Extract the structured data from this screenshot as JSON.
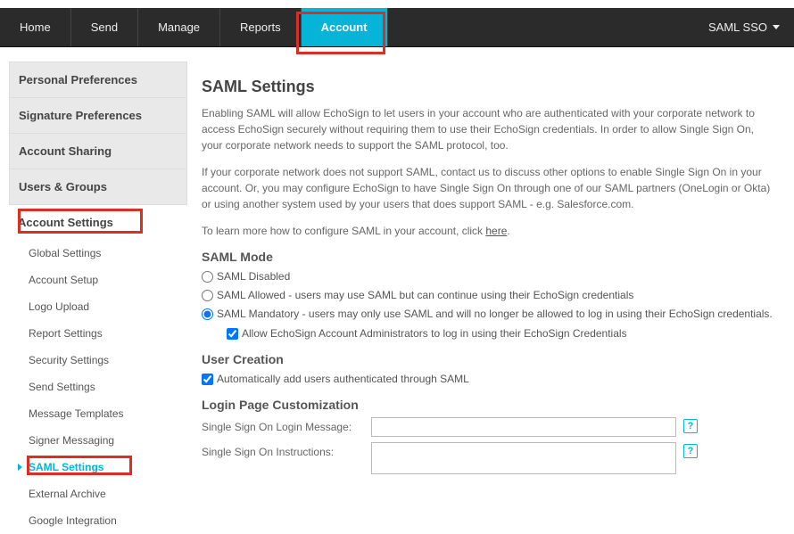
{
  "topnav": {
    "items": [
      "Home",
      "Send",
      "Manage",
      "Reports",
      "Account"
    ],
    "active_index": 4,
    "user_label": "SAML SSO"
  },
  "sidebar": {
    "sections": [
      "Personal Preferences",
      "Signature Preferences",
      "Account Sharing",
      "Users & Groups"
    ],
    "subhead": "Account Settings",
    "items": [
      "Global Settings",
      "Account Setup",
      "Logo Upload",
      "Report Settings",
      "Security Settings",
      "Send Settings",
      "Message Templates",
      "Signer Messaging",
      "SAML Settings",
      "External Archive",
      "Google Integration"
    ],
    "active_item_index": 8
  },
  "main": {
    "title": "SAML Settings",
    "p1": "Enabling SAML will allow EchoSign to let users in your account who are authenticated with your corporate network to access EchoSign securely without requiring them to use their EchoSign credentials. In order to allow Single Sign On, your corporate network needs to support the SAML protocol, too.",
    "p2": "If your corporate network does not support SAML, contact us to discuss other options to enable Single Sign On in your account. Or, you may configure EchoSign to have Single Sign On through one of our SAML partners (OneLogin or Okta) or using another system used by your users that does support SAML - e.g. Salesforce.com.",
    "p3_prefix": "To learn more how to configure SAML in your account, click ",
    "p3_link": "here",
    "p3_suffix": ".",
    "saml_mode": {
      "heading": "SAML Mode",
      "options": [
        "SAML Disabled",
        "SAML Allowed - users may use SAML but can continue using their EchoSign credentials",
        "SAML Mandatory - users may only use SAML and will no longer be allowed to log in using their EchoSign credentials."
      ],
      "selected_index": 2,
      "admin_checkbox": {
        "label": "Allow EchoSign Account Administrators to log in using their EchoSign Credentials",
        "checked": true
      }
    },
    "user_creation": {
      "heading": "User Creation",
      "checkbox": {
        "label": "Automatically add users authenticated through SAML",
        "checked": true
      }
    },
    "login_page": {
      "heading": "Login Page Customization",
      "msg_label": "Single Sign On Login Message:",
      "msg_value": "",
      "instr_label": "Single Sign On Instructions:",
      "instr_value": ""
    }
  }
}
